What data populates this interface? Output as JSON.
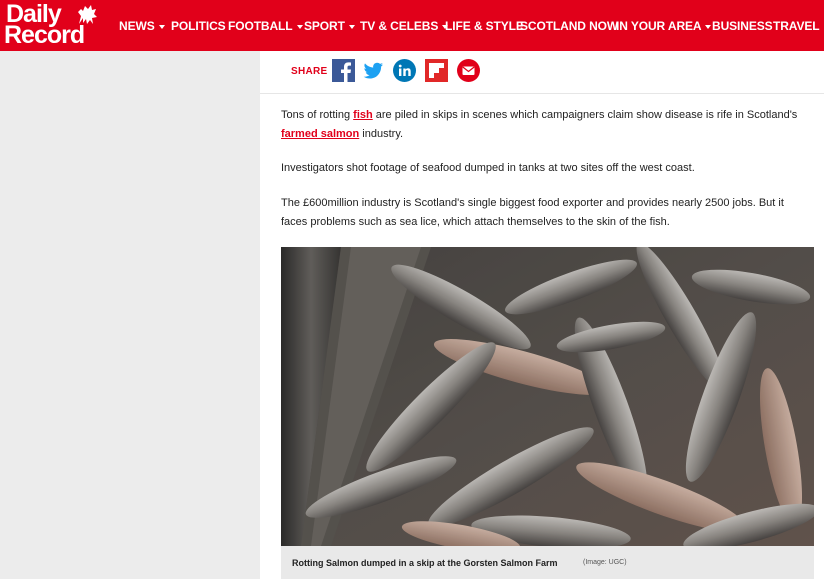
{
  "site": {
    "logo_line1": "Daily",
    "logo_line2": "Record",
    "logo_icon": "lion-crest-icon",
    "brand_color": "#e1001a"
  },
  "nav": {
    "items": [
      {
        "label": "NEWS",
        "dropdown": true
      },
      {
        "label": "POLITICS",
        "dropdown": false
      },
      {
        "label": "FOOTBALL",
        "dropdown": true
      },
      {
        "label": "SPORT",
        "dropdown": true
      },
      {
        "label": "TV & CELEBS",
        "dropdown": true
      },
      {
        "label": "LIFE & STYLE",
        "dropdown": false
      },
      {
        "label": "SCOTLAND NOW",
        "dropdown": false
      },
      {
        "label": "IN YOUR AREA",
        "dropdown": true
      },
      {
        "label": "BUSINESS",
        "dropdown": false
      },
      {
        "label": "TRAVEL",
        "dropdown": false
      }
    ]
  },
  "share": {
    "label": "SHARE",
    "buttons": [
      {
        "name": "facebook-icon",
        "color": "#3b5998"
      },
      {
        "name": "twitter-icon",
        "color": "#1da1f2"
      },
      {
        "name": "linkedin-icon",
        "color": "#0077b5"
      },
      {
        "name": "flipboard-icon",
        "color": "#e12828"
      },
      {
        "name": "email-icon",
        "color": "#e1001a"
      }
    ]
  },
  "article": {
    "p1_before": "Tons of rotting ",
    "p1_link1": "fish",
    "p1_middle": " are piled in skips in scenes which campaigners claim show disease is rife in Scotland's ",
    "p1_link2": "farmed salmon",
    "p1_after": " industry.",
    "p2": "Investigators shot footage of seafood dumped in tanks at two sites off the west coast.",
    "p3": "The £600million industry is Scotland's single biggest food exporter and provides nearly 2500 jobs. But it faces problems such as sea lice, which attach themselves to the skin of the fish.",
    "image_caption": "Rotting Salmon dumped in a skip at the Gorsten Salmon Farm",
    "image_credit": "(Image: UGC)"
  }
}
